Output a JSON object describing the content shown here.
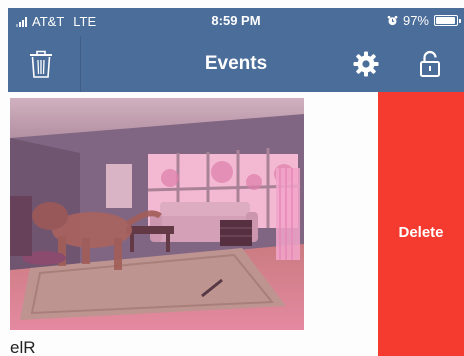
{
  "status_bar": {
    "carrier": "AT&T",
    "network": "LTE",
    "time": "8:59 PM",
    "battery_percent": "97%",
    "battery_level": 0.97
  },
  "nav_bar": {
    "title": "Events",
    "left_icon": "trash-icon",
    "right_icons": [
      "gear-icon",
      "lock-icon"
    ]
  },
  "event": {
    "label": "elR",
    "swipe_action_label": "Delete"
  },
  "colors": {
    "header": "#4b6d99",
    "delete": "#f53b30",
    "thumbnail_tint": "#ff3c8c"
  }
}
